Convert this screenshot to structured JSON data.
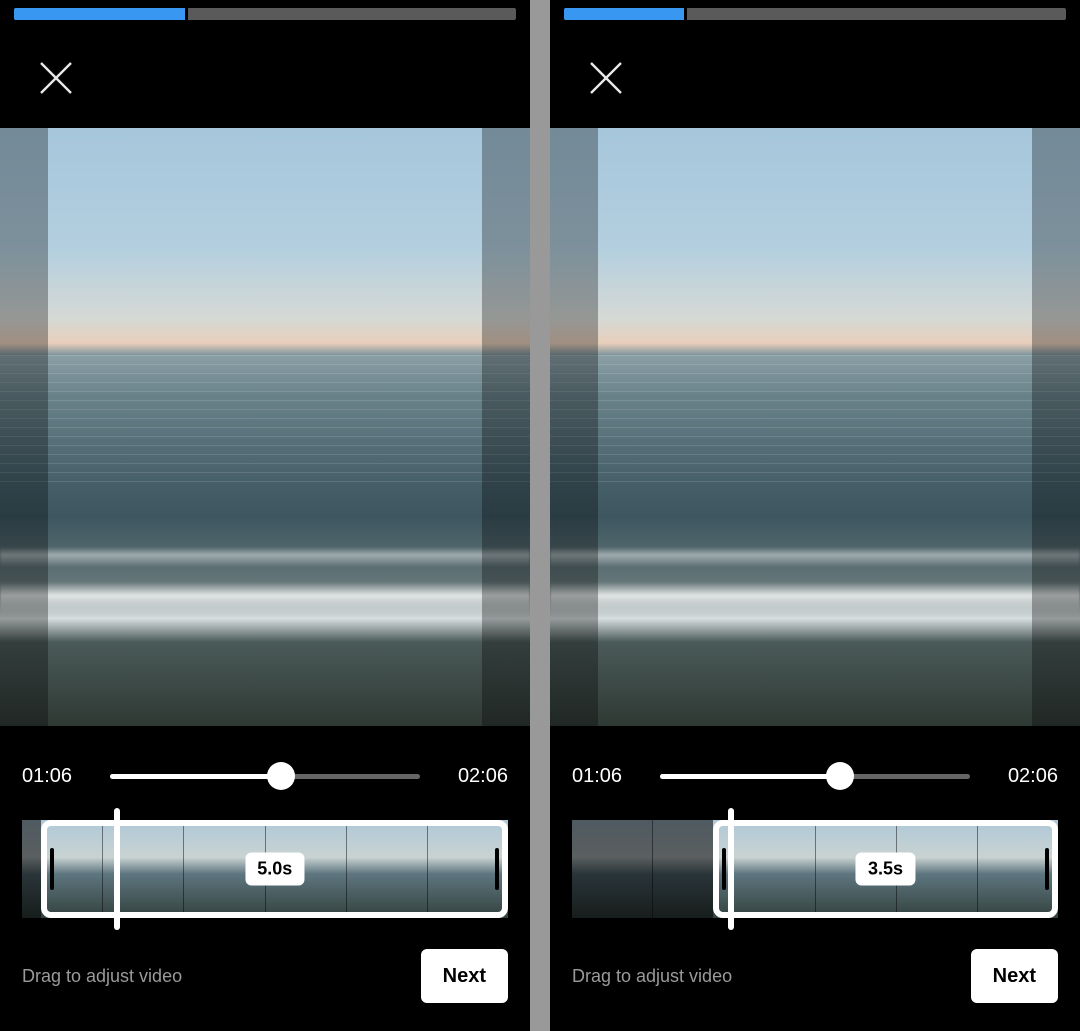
{
  "screens": [
    {
      "top_progress_percent": 34,
      "preview": {
        "shade_left": true,
        "shade_right": true
      },
      "scrubber": {
        "current": "01:06",
        "total": "02:06",
        "position_percent": 55
      },
      "trim": {
        "window_start_percent": 4,
        "window_end_percent": 100,
        "playhead_percent": 19,
        "duration_label": "5.0s"
      },
      "hint": "Drag to adjust video",
      "next_label": "Next"
    },
    {
      "top_progress_percent": 24,
      "preview": {
        "shade_left": true,
        "shade_right": true
      },
      "scrubber": {
        "current": "01:06",
        "total": "02:06",
        "position_percent": 58
      },
      "trim": {
        "window_start_percent": 29,
        "window_end_percent": 100,
        "playhead_percent": 32,
        "duration_label": "3.5s"
      },
      "hint": "Drag to adjust video",
      "next_label": "Next"
    }
  ]
}
